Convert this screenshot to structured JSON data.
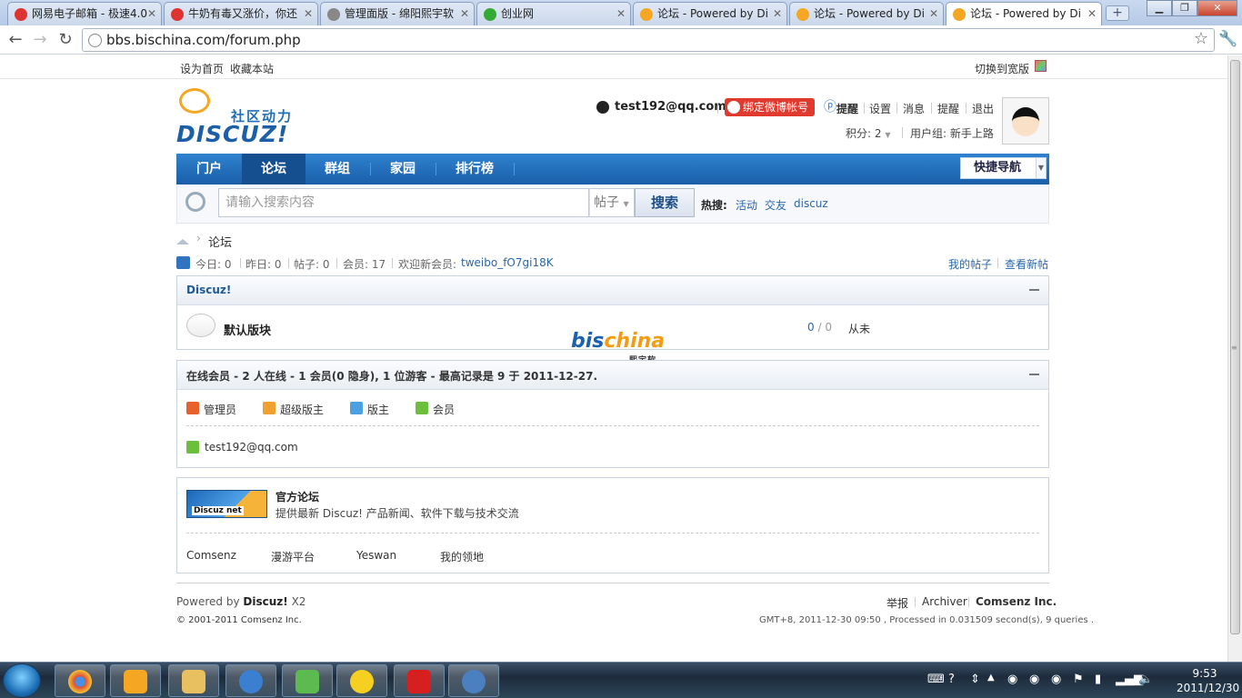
{
  "browser": {
    "tabs": [
      {
        "title": "网易电子邮箱 - 极速4.0",
        "icon": "netease-icon",
        "color": "#d33"
      },
      {
        "title": "牛奶有毒又涨价，你还",
        "icon": "weibo-icon",
        "color": "#d33"
      },
      {
        "title": "管理面版 - 绵阳熙宇软",
        "icon": "globe-icon",
        "color": "#888"
      },
      {
        "title": "创业网",
        "icon": "site-icon",
        "color": "#3a3"
      },
      {
        "title": "论坛 - Powered by Di",
        "icon": "discuz-icon",
        "color": "#f5a623"
      },
      {
        "title": "论坛 - Powered by Di",
        "icon": "discuz-icon",
        "color": "#f5a623"
      },
      {
        "title": "论坛 - Powered by Di",
        "icon": "discuz-icon",
        "color": "#f5a623"
      }
    ],
    "url": "bbs.bischina.com/forum.php"
  },
  "topbar": {
    "set_home": "设为首页",
    "bookmark": "收藏本站",
    "switch_wide": "切换到宽版"
  },
  "logo": {
    "cn": "社区动力",
    "en": "DISCUZ!"
  },
  "user": {
    "name": "test192@qq.com",
    "weibo": "绑定微博帐号",
    "menu": [
      "提醒",
      "设置",
      "消息",
      "提醒",
      "退出"
    ],
    "score": "积分: 2",
    "group": "用户组: 新手上路"
  },
  "nav": {
    "items": [
      "门户",
      "论坛",
      "群组",
      "家园",
      "排行榜"
    ],
    "active": "论坛",
    "quick": "快捷导航"
  },
  "search": {
    "placeholder": "请输入搜索内容",
    "type": "帖子",
    "button": "搜索",
    "hot_label": "热搜:",
    "hot": [
      "活动",
      "交友",
      "discuz"
    ]
  },
  "breadcrumb": {
    "sep": "›",
    "current": "论坛"
  },
  "stats": {
    "today": "今日: 0",
    "yesterday": "昨日: 0",
    "posts": "帖子: 0",
    "members": "会员: 17",
    "welcome": "欢迎新会员:",
    "newest": "tweibo_fO7gi18K",
    "my_posts": "我的帖子",
    "new_posts": "查看新帖"
  },
  "forum": {
    "category": "Discuz!",
    "board": "默认版块",
    "count_threads": "0",
    "count_slash": "/",
    "count_posts": "0",
    "last": "从未"
  },
  "online": {
    "title": "在线会员 - 2 人在线 - 1 会员(0 隐身), 1 位游客 - 最高记录是 9 于 2011-12-27.",
    "roles": [
      {
        "label": "管理员",
        "color": "#e8602c"
      },
      {
        "label": "超级版主",
        "color": "#f0a030"
      },
      {
        "label": "版主",
        "color": "#4aa0e0"
      },
      {
        "label": "会员",
        "color": "#6cbf3c"
      }
    ],
    "users": [
      "test192@qq.com"
    ]
  },
  "links": {
    "logo_text": "Discuz net",
    "official_name": "官方论坛",
    "official_desc": "提供最新 Discuz! 产品新闻、软件下载与技术交流",
    "friends": [
      "Comsenz",
      "漫游平台",
      "Yeswan",
      "我的领地"
    ]
  },
  "watermark": {
    "main_a": "bis",
    "main_b": "china",
    "sub": "熙宇软件"
  },
  "footer": {
    "powered_pre": "Powered by",
    "powered_brand": "Discuz!",
    "powered_ver": "X2",
    "copyright": "© 2001-2011 Comsenz Inc.",
    "links": [
      "举报",
      "Archiver",
      "Comsenz Inc."
    ],
    "processed": "GMT+8, 2011-12-30 09:50 , Processed in 0.031509 second(s), 9 queries ."
  },
  "taskbar": {
    "apps": [
      {
        "icon": "chrome-icon",
        "color": "#e04a3a"
      },
      {
        "icon": "media-player-icon",
        "color": "#f5a623"
      },
      {
        "icon": "explorer-icon",
        "color": "#e8c060"
      },
      {
        "icon": "mail-client-icon",
        "color": "#3a7fd0"
      },
      {
        "icon": "messenger-icon",
        "color": "#5cba50"
      },
      {
        "icon": "qq-icon",
        "color": "#f5d020"
      },
      {
        "icon": "m-app-icon",
        "color": "#d62020"
      },
      {
        "icon": "disc-tool-icon",
        "color": "#4a80c0"
      }
    ],
    "time": "9:53",
    "date": "2011/12/30"
  }
}
